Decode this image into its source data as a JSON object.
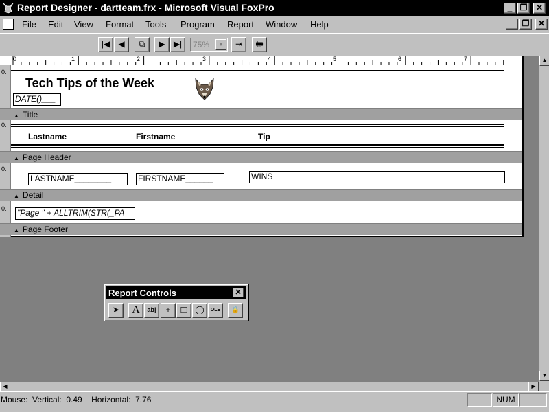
{
  "window": {
    "title": "Report Designer - dartteam.frx - Microsoft Visual FoxPro",
    "minimize_glyph": "_",
    "maximize_glyph": "❐",
    "close_glyph": "✕"
  },
  "menu": {
    "items": [
      "File",
      "Edit",
      "View",
      "Format",
      "Tools",
      "Program",
      "Report",
      "Window",
      "Help"
    ],
    "doc_controls": {
      "minimize_glyph": "_",
      "restore_glyph": "❐",
      "close_glyph": "✕"
    }
  },
  "toolbar": {
    "buttons": [
      {
        "icon": "first-record-icon",
        "glyph": "|◀"
      },
      {
        "icon": "previous-record-icon",
        "glyph": "◀"
      },
      {
        "icon": "goto-page-icon",
        "glyph": "⧉"
      },
      {
        "icon": "next-record-icon",
        "glyph": "▶"
      },
      {
        "icon": "last-record-icon",
        "glyph": "▶|"
      }
    ],
    "zoom_value": "75%",
    "close_preview_glyph": "⇥",
    "print_glyph": "🖶"
  },
  "ruler": {
    "marks": [
      "0",
      "1",
      "2",
      "3",
      "4",
      "5",
      "6",
      "7"
    ]
  },
  "vruler": {
    "mark": "0."
  },
  "report": {
    "title_band": {
      "heading": "Tech Tips of the Week",
      "date_field": "DATE()___",
      "logo_icon": "fox-logo-icon",
      "band_label": "Title"
    },
    "page_header_band": {
      "labels": [
        "Lastname",
        "Firstname",
        "Tip"
      ],
      "band_label": "Page Header"
    },
    "detail_band": {
      "fields": [
        "LASTNAME________",
        "FIRSTNAME______",
        "WINS"
      ],
      "band_label": "Detail"
    },
    "page_footer_band": {
      "expression": "\"Page \" + ALLTRIM(STR(_PA",
      "band_label": "Page Footer"
    }
  },
  "palette": {
    "title": "Report Controls",
    "close_glyph": "✕",
    "tools": [
      {
        "icon": "pointer-icon",
        "glyph": "➤"
      },
      {
        "icon": "label-tool-icon",
        "glyph": "A"
      },
      {
        "icon": "field-tool-icon",
        "glyph": "ab|"
      },
      {
        "icon": "line-tool-icon",
        "glyph": "+"
      },
      {
        "icon": "rectangle-tool-icon",
        "glyph": "□"
      },
      {
        "icon": "rounded-rectangle-tool-icon",
        "glyph": "◯"
      },
      {
        "icon": "picture-ole-tool-icon",
        "glyph": "OLE"
      },
      {
        "icon": "button-lock-icon",
        "glyph": "🔒"
      }
    ]
  },
  "scrollbars": {
    "up_glyph": "▲",
    "down_glyph": "▼",
    "left_glyph": "◀",
    "right_glyph": "▶"
  },
  "status": {
    "mouse_text": "Mouse:  Vertical:  0.49    Horizontal:  7.76",
    "num_indicator": "NUM"
  },
  "colors": {
    "titlebar": "#000000",
    "workspace": "#808080",
    "band_bar": "#a0a0a0",
    "chrome": "#c0c0c0"
  }
}
